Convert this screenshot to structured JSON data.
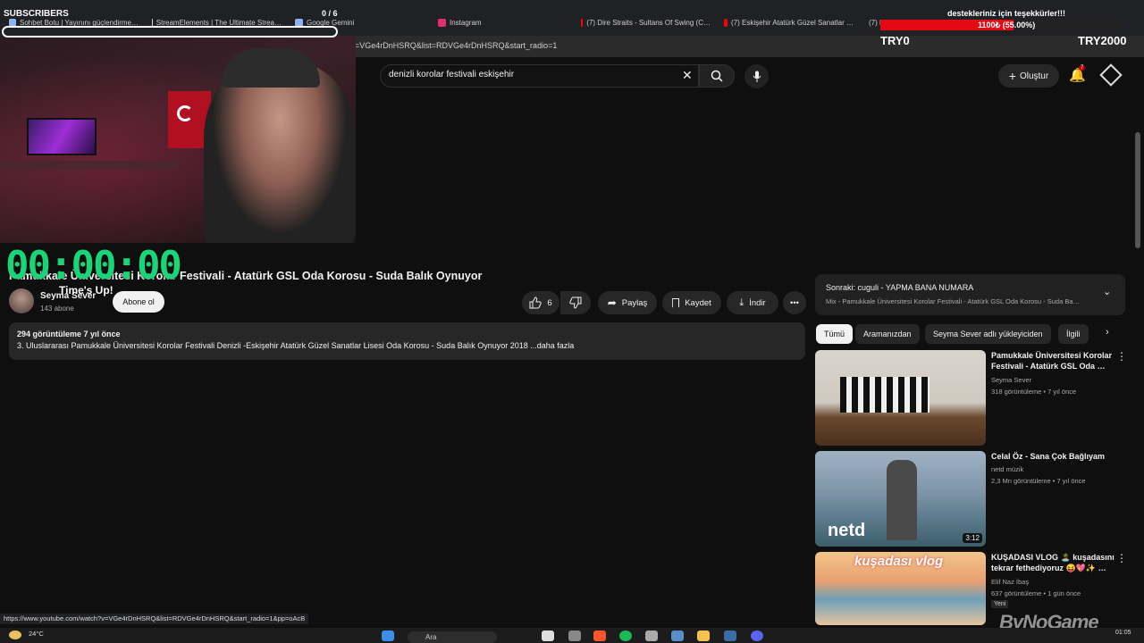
{
  "browser": {
    "tabs": [
      {
        "label": "Sohbet Botu | Yayınını güçlendirme…",
        "color": "#8ab4f8"
      },
      {
        "label": "StreamElements | The Ultimate Strea…",
        "color": "#cfcfcf"
      },
      {
        "label": "Google Gemini",
        "color": "#8ab4f8"
      },
      {
        "label": "Instagram",
        "color": "#e1306c"
      },
      {
        "label": "(7) Dire Straits - Sultans Of Swing (C…",
        "color": "#ff0000"
      },
      {
        "label": "(7) Eskişehir Atatürk Güzel Sanatlar …",
        "color": "#ff0000"
      },
      {
        "label": "(7) Pamukkale…",
        "color": "#ff0000"
      }
    ],
    "url": "=VGe4rDnHSRQ&list=RDVGe4rDnHSRQ&start_radio=1",
    "status_url": "https://www.youtube.com/watch?v=VGe4rDnHSRQ&list=RDVGe4rDnHSRQ&start_radio=1&pp=oAcB"
  },
  "overlay": {
    "subscribers_label": "SUBSCRIBERS",
    "subscribers_count": "0 / 6",
    "goal_label": "destekleriniz için teşekkürler!!!",
    "goal_text": "1100₺ (55.00%)",
    "goal_fraction": 0.55,
    "goal_left": "TRY0",
    "goal_right": "TRY2000",
    "timer": "00:00:00",
    "timer_caption": "Time's Up!",
    "watermark": "ByNoGame"
  },
  "header": {
    "search_value": "denizli korolar festivali eskişehir",
    "create_label": "Oluştur",
    "notifications": "7"
  },
  "video": {
    "title": "Pamukkale Üniversitesi Korolar Festivali - Atatürk GSL Oda Korosu - Suda Balık Oynuyor",
    "channel": "Seyma Sever",
    "subs": "143 abone",
    "subscribe_label": "Abone ol",
    "likes": "6",
    "share_label": "Paylaş",
    "save_label": "Kaydet",
    "download_label": "İndir",
    "desc_meta": "294 görüntüleme  7 yıl önce",
    "desc_text": "3. Uluslararası Pamukkale Üniversitesi Korolar Festivali Denizli -Eskişehir Atatürk Güzel Sanatlar Lisesi Oda Korosu - Suda Balık Oynuyor 2018 ...daha fazla"
  },
  "queue": {
    "next": "Sonraki: cuguli - YAPMA BANA NUMARA",
    "mix": "Mix - Pamukkale Üniversitesi Korolar Festivali - Atatürk GSL Oda Korosu - Suda Ba…"
  },
  "chips": [
    "Tümü",
    "Aramanızdan",
    "Seyma Sever adlı yükleyiciden",
    "İlgili"
  ],
  "recommendations": [
    {
      "title": "Pamukkale Üniversitesi Korolar Festivali - Atatürk GSL Oda …",
      "channel": "Seyma Sever",
      "meta": "318 görüntüleme • 7 yıl önce",
      "duration": ""
    },
    {
      "title": "Celal Öz - Sana Çok Bağlıyam",
      "channel": "netd müzik",
      "meta": "2,3 Mn görüntüleme • 7 yıl önce",
      "duration": "3:12",
      "thumb_text": "netd"
    },
    {
      "title": "KUŞADASI VLOG 🏝️ kuşadasını tekrar fethediyoruz 😝💖✨ …",
      "channel": "Elif Naz İbaş",
      "meta": "637 görüntüleme • 1 gün önce",
      "badge": "Yeni",
      "thumb_text": "kuşadası vlog"
    }
  ],
  "taskbar": {
    "temperature": "24°C",
    "search_label": "Ara",
    "time": "01:05"
  }
}
